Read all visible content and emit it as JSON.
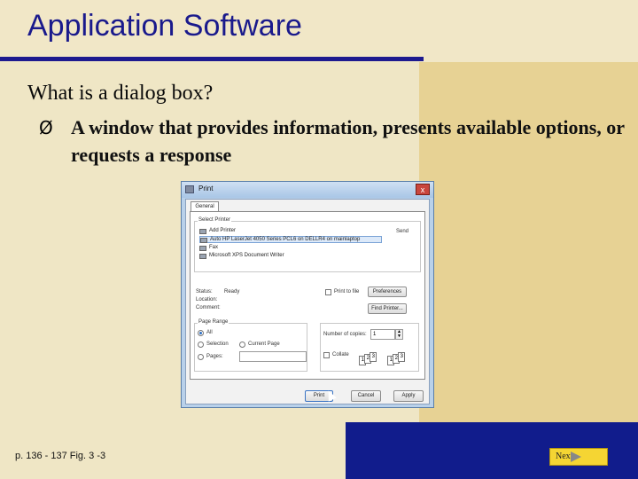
{
  "slide": {
    "title": "Application Software",
    "question": "What is a dialog box?",
    "bullet_marker": "Ø",
    "bullet_text": "A window that provides information, presents available options, or requests a response",
    "footer_reference": "p. 136 - 137 Fig. 3 -3",
    "next_label": "Next"
  },
  "dialog": {
    "title": "Print",
    "close_glyph": "x",
    "tab": "General",
    "select_printer_label": "Select Printer",
    "printers": [
      "Add Printer",
      "Auto HP LaserJet 4050 Series PCL6 on DELLR4 on mainlaptop",
      "Fax",
      "Microsoft XPS Document Writer"
    ],
    "printer_right_label": "Send",
    "status_label": "Status:",
    "status_value": "Ready",
    "location_label": "Location:",
    "comment_label": "Comment:",
    "print_to_file_label": "Print to file",
    "preferences_button": "Preferences",
    "find_printer_button": "Find Printer...",
    "page_range_label": "Page Range",
    "range_all": "All",
    "range_selection": "Selection",
    "range_current": "Current Page",
    "range_pages": "Pages:",
    "copies_label": "Number of copies:",
    "copies_value": "1",
    "collate_label": "Collate",
    "buttons": {
      "print": "Print",
      "cancel": "Cancel",
      "apply": "Apply"
    }
  }
}
